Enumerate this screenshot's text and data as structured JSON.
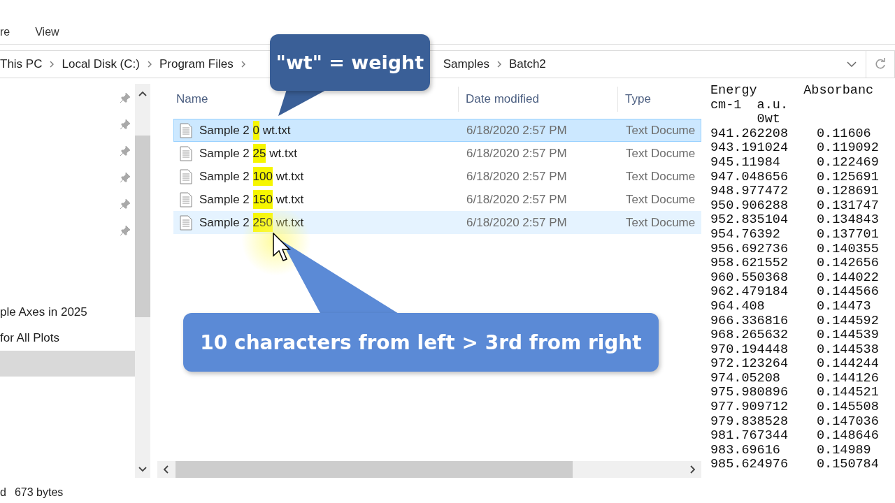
{
  "ribbon": {
    "tabs": [
      {
        "label": "re"
      },
      {
        "label": "View"
      }
    ]
  },
  "address_bar": {
    "breadcrumbs": [
      "This PC",
      "Local Disk (C:)",
      "Program Files",
      "Samples",
      "Batch2"
    ]
  },
  "nav_pane": {
    "items": [
      {
        "label": "ple Axes in 2025",
        "selected": false
      },
      {
        "label": "for All Plots",
        "selected": false
      },
      {
        "selected": true
      }
    ]
  },
  "file_list": {
    "columns": [
      "Name",
      "Date modified",
      "Type"
    ],
    "rows": [
      {
        "name_prefix": "Sample 2 ",
        "highlight": "0",
        "name_suffix": " wt.txt",
        "date": "6/18/2020 2:57 PM",
        "type": "Text Docume",
        "selected": true,
        "hovered": false
      },
      {
        "name_prefix": "Sample 2 ",
        "highlight": "25",
        "name_suffix": " wt.txt",
        "date": "6/18/2020 2:57 PM",
        "type": "Text Docume",
        "selected": false,
        "hovered": false
      },
      {
        "name_prefix": "Sample 2 ",
        "highlight": "100",
        "name_suffix": " wt.txt",
        "date": "6/18/2020 2:57 PM",
        "type": "Text Docume",
        "selected": false,
        "hovered": false
      },
      {
        "name_prefix": "Sample 2 ",
        "highlight": "150",
        "name_suffix": " wt.txt",
        "date": "6/18/2020 2:57 PM",
        "type": "Text Docume",
        "selected": false,
        "hovered": false
      },
      {
        "name_prefix": "Sample 2 ",
        "highlight": "250",
        "name_suffix": " wt.txt",
        "date": "6/18/2020 2:57 PM",
        "type": "Text Docume",
        "selected": false,
        "hovered": true
      }
    ]
  },
  "preview": {
    "header_lines": [
      "Energy      Absorbanc",
      "cm-1  a.u.",
      "      0wt"
    ],
    "rows": [
      [
        "941.262208",
        "0.11606"
      ],
      [
        "943.191024",
        "0.119092"
      ],
      [
        "945.11984",
        "0.122469"
      ],
      [
        "947.048656",
        "0.125691"
      ],
      [
        "948.977472",
        "0.128691"
      ],
      [
        "950.906288",
        "0.131747"
      ],
      [
        "952.835104",
        "0.134843"
      ],
      [
        "954.76392",
        "0.137701"
      ],
      [
        "956.692736",
        "0.140355"
      ],
      [
        "958.621552",
        "0.142656"
      ],
      [
        "960.550368",
        "0.144022"
      ],
      [
        "962.479184",
        "0.144566"
      ],
      [
        "964.408",
        "0.14473"
      ],
      [
        "966.336816",
        "0.144592"
      ],
      [
        "968.265632",
        "0.144539"
      ],
      [
        "970.194448",
        "0.144538"
      ],
      [
        "972.123264",
        "0.144244"
      ],
      [
        "974.05208",
        "0.144126"
      ],
      [
        "975.980896",
        "0.144521"
      ],
      [
        "977.909712",
        "0.145508"
      ],
      [
        "979.838528",
        "0.147036"
      ],
      [
        "981.767344",
        "0.148646"
      ],
      [
        "983.69616",
        "0.14989"
      ],
      [
        "985.624976",
        "0.150784"
      ]
    ]
  },
  "status_bar": {
    "texts": [
      "d",
      "673 bytes"
    ]
  },
  "callouts": [
    {
      "kind": "top",
      "text": "\"wt\" = weight"
    },
    {
      "kind": "bottom",
      "text": "10 characters from left > 3rd from right"
    }
  ]
}
